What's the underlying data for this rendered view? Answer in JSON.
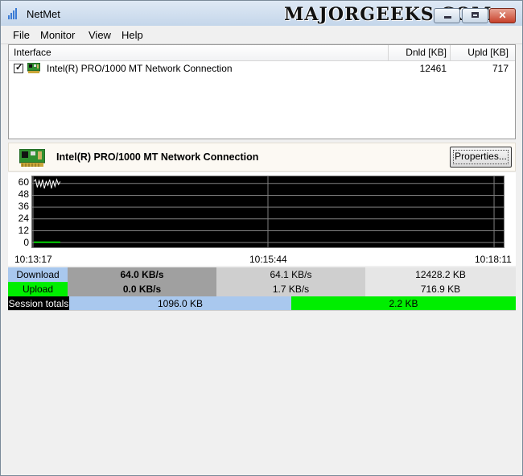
{
  "window": {
    "title": "NetMet",
    "watermark": "MAJORGEEKS.COM"
  },
  "menu": [
    "File",
    "Monitor",
    "View",
    "Help"
  ],
  "interfaces": {
    "columns": [
      "Interface",
      "Dnld [KB]",
      "Upld [KB]"
    ],
    "rows": [
      {
        "checked": true,
        "name": "Intel(R) PRO/1000 MT Network Connection",
        "dnld": "12461",
        "upld": "717"
      }
    ]
  },
  "detail": {
    "title": "Intel(R) PRO/1000 MT Network Connection",
    "properties_label": "Properties..."
  },
  "chart_data": {
    "type": "line",
    "y_ticks": [
      "60",
      "48",
      "36",
      "24",
      "12",
      "0"
    ],
    "ylim": [
      0,
      64
    ],
    "x_ticks": [
      "10:13:17",
      "10:15:44",
      "10:18:11"
    ],
    "grid": true,
    "series": [
      {
        "color": "#ffffff",
        "x": [
          0,
          1,
          2,
          3,
          4,
          5,
          6,
          7,
          8,
          9,
          10,
          11,
          12,
          13,
          14,
          15
        ],
        "values": [
          62,
          64,
          56,
          63,
          57,
          64,
          55,
          62,
          58,
          64,
          55,
          63,
          57,
          64,
          59,
          62
        ]
      },
      {
        "color": "#00d000",
        "x": [
          0,
          15
        ],
        "values": [
          0.3,
          0.3
        ]
      }
    ]
  },
  "stats": {
    "download": {
      "label": "Download",
      "current": "64.0 KB/s",
      "average": "64.1 KB/s",
      "total": "12428.2 KB"
    },
    "upload": {
      "label": "Upload",
      "current": "0.0 KB/s",
      "average": "1.7 KB/s",
      "total": "716.9 KB"
    },
    "session": {
      "label": "Session totals",
      "download": "1096.0 KB",
      "upload": "2.2 KB"
    }
  },
  "colors": {
    "download_accent": "#a9c8ee",
    "upload_accent": "#00ee00",
    "plot_background": "#000000"
  }
}
